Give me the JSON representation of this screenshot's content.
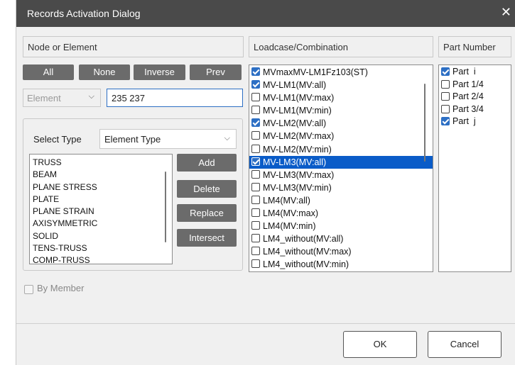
{
  "window": {
    "title": "Records Activation Dialog",
    "close_glyph": "✕"
  },
  "node_element": {
    "header": "Node or Element",
    "buttons": {
      "all": "All",
      "none": "None",
      "inverse": "Inverse",
      "prev": "Prev"
    },
    "type_select": {
      "value": "Element",
      "disabled": true
    },
    "id_input": {
      "value": "235 237"
    },
    "select_type": {
      "label": "Select Type",
      "value": "Element Type"
    },
    "type_list": [
      "TRUSS",
      "BEAM",
      "PLANE STRESS",
      "PLATE",
      "PLANE STRAIN",
      "AXISYMMETRIC",
      "SOLID",
      "TENS-TRUSS",
      "COMP-TRUSS"
    ],
    "actions": {
      "add": "Add",
      "delete": "Delete",
      "replace": "Replace",
      "intersect": "Intersect"
    }
  },
  "loadcase": {
    "header": "Loadcase/Combination",
    "items": [
      {
        "label": "MVmaxMV-LM1Fz103(ST)",
        "checked": true,
        "selected": false
      },
      {
        "label": "MV-LM1(MV:all)",
        "checked": true,
        "selected": false
      },
      {
        "label": "MV-LM1(MV:max)",
        "checked": false,
        "selected": false
      },
      {
        "label": "MV-LM1(MV:min)",
        "checked": false,
        "selected": false
      },
      {
        "label": "MV-LM2(MV:all)",
        "checked": true,
        "selected": false
      },
      {
        "label": "MV-LM2(MV:max)",
        "checked": false,
        "selected": false
      },
      {
        "label": "MV-LM2(MV:min)",
        "checked": false,
        "selected": false
      },
      {
        "label": "MV-LM3(MV:all)",
        "checked": true,
        "selected": true
      },
      {
        "label": "MV-LM3(MV:max)",
        "checked": false,
        "selected": false
      },
      {
        "label": "MV-LM3(MV:min)",
        "checked": false,
        "selected": false
      },
      {
        "label": "LM4(MV:all)",
        "checked": false,
        "selected": false
      },
      {
        "label": "LM4(MV:max)",
        "checked": false,
        "selected": false
      },
      {
        "label": "LM4(MV:min)",
        "checked": false,
        "selected": false
      },
      {
        "label": "LM4_without(MV:all)",
        "checked": false,
        "selected": false
      },
      {
        "label": "LM4_without(MV:max)",
        "checked": false,
        "selected": false
      },
      {
        "label": "LM4_without(MV:min)",
        "checked": false,
        "selected": false
      }
    ]
  },
  "part_number": {
    "header": "Part Number",
    "items": [
      {
        "label": "Part  i",
        "checked": true
      },
      {
        "label": "Part 1/4",
        "checked": false
      },
      {
        "label": "Part 2/4",
        "checked": false
      },
      {
        "label": "Part 3/4",
        "checked": false
      },
      {
        "label": "Part  j",
        "checked": true
      }
    ]
  },
  "by_member": {
    "label": "By Member",
    "checked": false,
    "disabled": true
  },
  "footer": {
    "ok": "OK",
    "cancel": "Cancel"
  },
  "colors": {
    "title_bar": "#4a4a4a",
    "dark_button": "#6b6b6b",
    "selection": "#0a5cc8",
    "check": "#2d6fc4"
  }
}
